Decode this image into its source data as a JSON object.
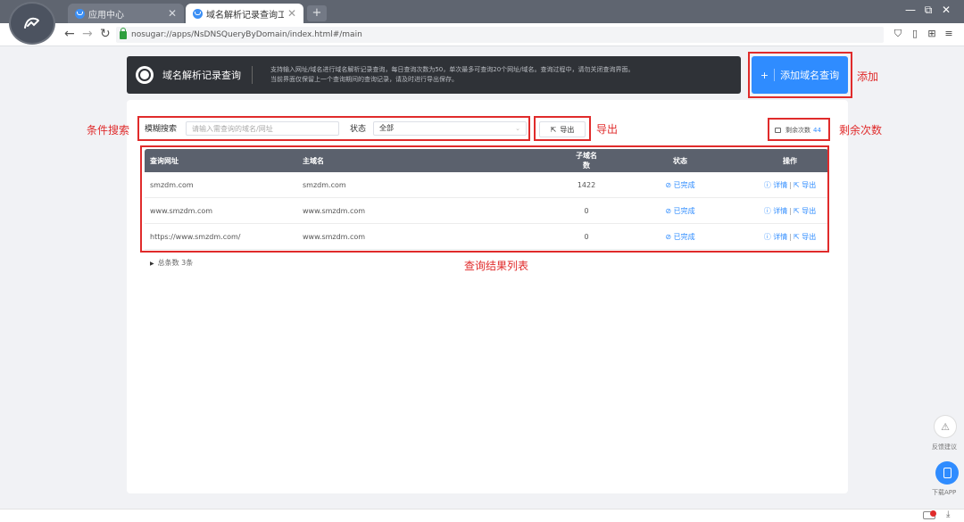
{
  "browser": {
    "tabs": [
      {
        "label": "应用中心",
        "active": false
      },
      {
        "label": "域名解析记录查询工具",
        "active": true
      }
    ],
    "new_tab": "+",
    "url": "nosugar://apps/NsDNSQueryByDomain/index.html#/main"
  },
  "banner": {
    "title": "域名解析记录查询",
    "desc_line1": "支持输入网址/域名进行域名解析记录查询，每日查询次数为50，单次最多可查询20个网址/域名。查询过程中，请勿关闭查询界面。",
    "desc_line2": "当前界面仅保留上一个查询期间的查询记录，请及时进行导出保存。"
  },
  "add_button": {
    "plus": "+",
    "label": "添加域名查询"
  },
  "filters": {
    "search_label": "模糊搜索",
    "search_placeholder": "请输入需查询的域名/网址",
    "status_label": "状态",
    "status_value": "全部",
    "export_label": "导出"
  },
  "remaining": {
    "label": "剩余次数",
    "value": "44"
  },
  "table": {
    "headers": [
      "查询网址",
      "主域名",
      "子域名数",
      "状态",
      "操作"
    ],
    "rows": [
      {
        "url": "smzdm.com",
        "domain": "smzdm.com",
        "subs": "1422",
        "status": "已完成"
      },
      {
        "url": "www.smzdm.com",
        "domain": "www.smzdm.com",
        "subs": "0",
        "status": "已完成"
      },
      {
        "url": "https://www.smzdm.com/",
        "domain": "www.smzdm.com",
        "subs": "0",
        "status": "已完成"
      }
    ],
    "op_detail": "详情",
    "op_sep": "|",
    "op_export": "导出"
  },
  "total": "总条数 3条",
  "annotations": {
    "add": "添加",
    "filter": "条件搜索",
    "export": "导出",
    "remaining": "剩余次数",
    "results": "查询结果列表"
  },
  "float": {
    "feedback": "反馈建议",
    "download": "下载APP"
  },
  "colors": {
    "accent": "#2f8cff",
    "annotation": "#e02b2b",
    "banner": "#2f3237",
    "table_head": "#5b616d"
  },
  "icons": [
    "app-logo-icon",
    "tab-app-icon",
    "back-icon",
    "forward-icon",
    "reload-icon",
    "lock-icon",
    "shield-icon",
    "tablet-icon",
    "grid-icon",
    "menu-icon",
    "export-icon",
    "check-circle-icon",
    "info-icon",
    "warning-icon",
    "phone-icon"
  ]
}
